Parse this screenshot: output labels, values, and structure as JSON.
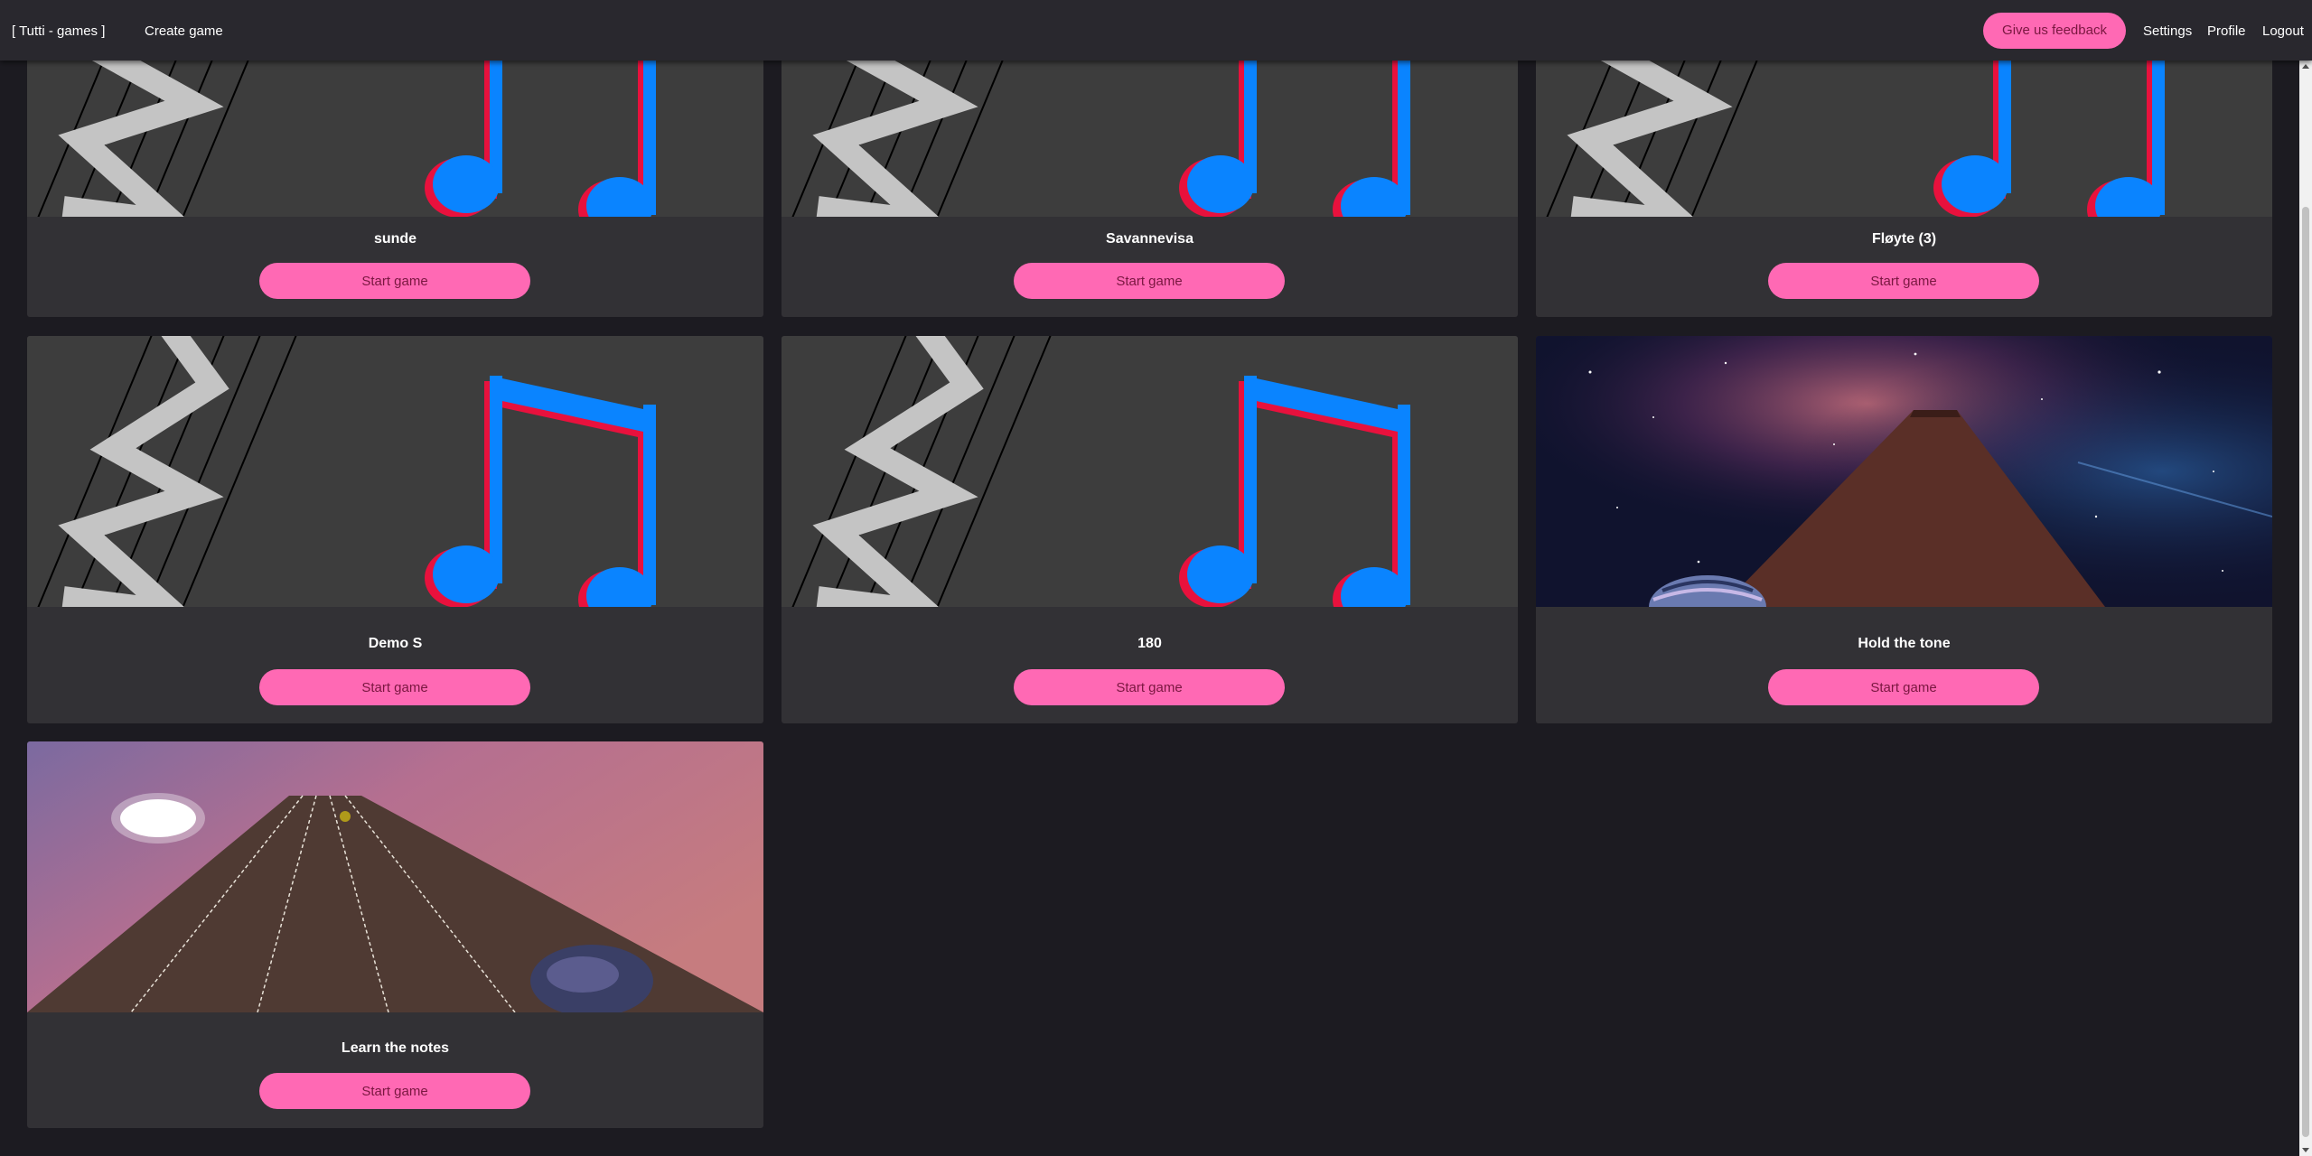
{
  "header": {
    "brand": "[ Tutti - games ]",
    "create_game": "Create game",
    "feedback": "Give us feedback",
    "settings": "Settings",
    "profile": "Profile",
    "logout": "Logout"
  },
  "games": [
    {
      "title": "sunde",
      "button": "Start game",
      "image": "music-notes-icon"
    },
    {
      "title": "Savannevisa",
      "button": "Start game",
      "image": "music-notes-icon"
    },
    {
      "title": "Fløyte (3)",
      "button": "Start game",
      "image": "music-notes-icon"
    },
    {
      "title": "Demo S",
      "button": "Start game",
      "image": "music-notes-icon"
    },
    {
      "title": "180",
      "button": "Start game",
      "image": "music-notes-icon"
    },
    {
      "title": "Hold the tone",
      "button": "Start game",
      "image": "space-track-scene"
    },
    {
      "title": "Learn the notes",
      "button": "Start game",
      "image": "sunset-track-scene"
    }
  ],
  "colors": {
    "accent": "#ff69b4",
    "background": "#1c1b21",
    "card": "#323135",
    "note_blue": "#0a84ff",
    "note_red": "#e8113d"
  }
}
